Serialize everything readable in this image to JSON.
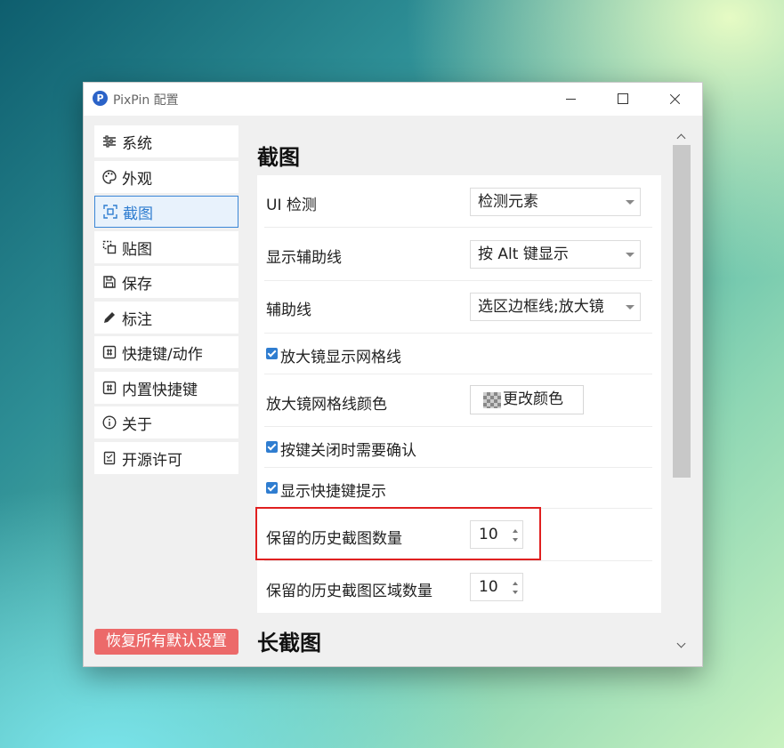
{
  "window": {
    "title": "PixPin 配置",
    "logo_letter": "P"
  },
  "sidebar": {
    "items": [
      {
        "label": "系统",
        "icon": "sliders-icon"
      },
      {
        "label": "外观",
        "icon": "palette-icon"
      },
      {
        "label": "截图",
        "icon": "screenshot-icon",
        "active": true
      },
      {
        "label": "贴图",
        "icon": "pin-icon"
      },
      {
        "label": "保存",
        "icon": "save-icon"
      },
      {
        "label": "标注",
        "icon": "pencil-icon"
      },
      {
        "label": "快捷键/动作",
        "icon": "hotkey-icon"
      },
      {
        "label": "内置快捷键",
        "icon": "builtin-hotkey-icon"
      },
      {
        "label": "关于",
        "icon": "info-icon"
      },
      {
        "label": "开源许可",
        "icon": "license-icon"
      }
    ],
    "reset_label": "恢复所有默认设置"
  },
  "content": {
    "section_title": "截图",
    "next_section_title": "长截图",
    "settings": {
      "ui_detect": {
        "label": "UI 检测",
        "value": "检测元素"
      },
      "guide_display": {
        "label": "显示辅助线",
        "value": "按 Alt 键显示"
      },
      "guides": {
        "label": "辅助线",
        "value": "选区边框线;放大镜"
      },
      "magnifier_grid": {
        "label": "放大镜显示网格线",
        "checked": true
      },
      "grid_color": {
        "label": "放大镜网格线颜色",
        "button": "更改颜色"
      },
      "confirm_close": {
        "label": "按键关闭时需要确认",
        "checked": true
      },
      "show_hotkey_hint": {
        "label": "显示快捷键提示",
        "checked": true
      },
      "history_count": {
        "label": "保留的历史截图数量",
        "value": "10"
      },
      "history_region_count": {
        "label": "保留的历史截图区域数量",
        "value": "10"
      }
    }
  },
  "colors": {
    "accent": "#2f7dd0",
    "reset": "#ec6a6a",
    "highlight": "#e02020"
  }
}
